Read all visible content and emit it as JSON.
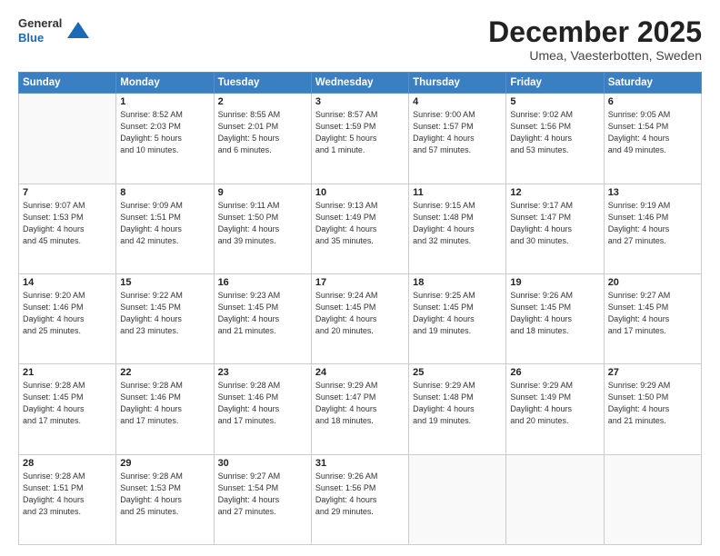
{
  "logo": {
    "general": "General",
    "blue": "Blue"
  },
  "title": "December 2025",
  "location": "Umea, Vaesterbotten, Sweden",
  "weekdays": [
    "Sunday",
    "Monday",
    "Tuesday",
    "Wednesday",
    "Thursday",
    "Friday",
    "Saturday"
  ],
  "weeks": [
    [
      {
        "day": "",
        "info": ""
      },
      {
        "day": "1",
        "info": "Sunrise: 8:52 AM\nSunset: 2:03 PM\nDaylight: 5 hours\nand 10 minutes."
      },
      {
        "day": "2",
        "info": "Sunrise: 8:55 AM\nSunset: 2:01 PM\nDaylight: 5 hours\nand 6 minutes."
      },
      {
        "day": "3",
        "info": "Sunrise: 8:57 AM\nSunset: 1:59 PM\nDaylight: 5 hours\nand 1 minute."
      },
      {
        "day": "4",
        "info": "Sunrise: 9:00 AM\nSunset: 1:57 PM\nDaylight: 4 hours\nand 57 minutes."
      },
      {
        "day": "5",
        "info": "Sunrise: 9:02 AM\nSunset: 1:56 PM\nDaylight: 4 hours\nand 53 minutes."
      },
      {
        "day": "6",
        "info": "Sunrise: 9:05 AM\nSunset: 1:54 PM\nDaylight: 4 hours\nand 49 minutes."
      }
    ],
    [
      {
        "day": "7",
        "info": "Sunrise: 9:07 AM\nSunset: 1:53 PM\nDaylight: 4 hours\nand 45 minutes."
      },
      {
        "day": "8",
        "info": "Sunrise: 9:09 AM\nSunset: 1:51 PM\nDaylight: 4 hours\nand 42 minutes."
      },
      {
        "day": "9",
        "info": "Sunrise: 9:11 AM\nSunset: 1:50 PM\nDaylight: 4 hours\nand 39 minutes."
      },
      {
        "day": "10",
        "info": "Sunrise: 9:13 AM\nSunset: 1:49 PM\nDaylight: 4 hours\nand 35 minutes."
      },
      {
        "day": "11",
        "info": "Sunrise: 9:15 AM\nSunset: 1:48 PM\nDaylight: 4 hours\nand 32 minutes."
      },
      {
        "day": "12",
        "info": "Sunrise: 9:17 AM\nSunset: 1:47 PM\nDaylight: 4 hours\nand 30 minutes."
      },
      {
        "day": "13",
        "info": "Sunrise: 9:19 AM\nSunset: 1:46 PM\nDaylight: 4 hours\nand 27 minutes."
      }
    ],
    [
      {
        "day": "14",
        "info": "Sunrise: 9:20 AM\nSunset: 1:46 PM\nDaylight: 4 hours\nand 25 minutes."
      },
      {
        "day": "15",
        "info": "Sunrise: 9:22 AM\nSunset: 1:45 PM\nDaylight: 4 hours\nand 23 minutes."
      },
      {
        "day": "16",
        "info": "Sunrise: 9:23 AM\nSunset: 1:45 PM\nDaylight: 4 hours\nand 21 minutes."
      },
      {
        "day": "17",
        "info": "Sunrise: 9:24 AM\nSunset: 1:45 PM\nDaylight: 4 hours\nand 20 minutes."
      },
      {
        "day": "18",
        "info": "Sunrise: 9:25 AM\nSunset: 1:45 PM\nDaylight: 4 hours\nand 19 minutes."
      },
      {
        "day": "19",
        "info": "Sunrise: 9:26 AM\nSunset: 1:45 PM\nDaylight: 4 hours\nand 18 minutes."
      },
      {
        "day": "20",
        "info": "Sunrise: 9:27 AM\nSunset: 1:45 PM\nDaylight: 4 hours\nand 17 minutes."
      }
    ],
    [
      {
        "day": "21",
        "info": "Sunrise: 9:28 AM\nSunset: 1:45 PM\nDaylight: 4 hours\nand 17 minutes."
      },
      {
        "day": "22",
        "info": "Sunrise: 9:28 AM\nSunset: 1:46 PM\nDaylight: 4 hours\nand 17 minutes."
      },
      {
        "day": "23",
        "info": "Sunrise: 9:28 AM\nSunset: 1:46 PM\nDaylight: 4 hours\nand 17 minutes."
      },
      {
        "day": "24",
        "info": "Sunrise: 9:29 AM\nSunset: 1:47 PM\nDaylight: 4 hours\nand 18 minutes."
      },
      {
        "day": "25",
        "info": "Sunrise: 9:29 AM\nSunset: 1:48 PM\nDaylight: 4 hours\nand 19 minutes."
      },
      {
        "day": "26",
        "info": "Sunrise: 9:29 AM\nSunset: 1:49 PM\nDaylight: 4 hours\nand 20 minutes."
      },
      {
        "day": "27",
        "info": "Sunrise: 9:29 AM\nSunset: 1:50 PM\nDaylight: 4 hours\nand 21 minutes."
      }
    ],
    [
      {
        "day": "28",
        "info": "Sunrise: 9:28 AM\nSunset: 1:51 PM\nDaylight: 4 hours\nand 23 minutes."
      },
      {
        "day": "29",
        "info": "Sunrise: 9:28 AM\nSunset: 1:53 PM\nDaylight: 4 hours\nand 25 minutes."
      },
      {
        "day": "30",
        "info": "Sunrise: 9:27 AM\nSunset: 1:54 PM\nDaylight: 4 hours\nand 27 minutes."
      },
      {
        "day": "31",
        "info": "Sunrise: 9:26 AM\nSunset: 1:56 PM\nDaylight: 4 hours\nand 29 minutes."
      },
      {
        "day": "",
        "info": ""
      },
      {
        "day": "",
        "info": ""
      },
      {
        "day": "",
        "info": ""
      }
    ]
  ]
}
